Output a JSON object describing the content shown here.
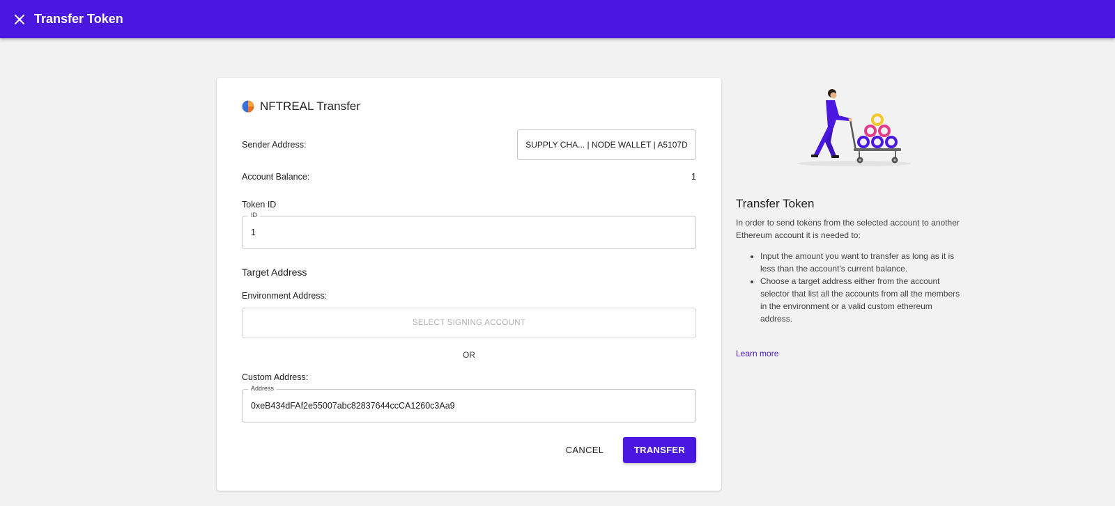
{
  "topbar": {
    "title": "Transfer Token",
    "close_icon": "close-icon",
    "background_color": "#4a17e0"
  },
  "form": {
    "title": "NFTREAL Transfer",
    "token_icon": "token-icon",
    "sender_label": "Sender Address:",
    "sender_value": "SUPPLY CHA... | NODE WALLET | A5107D",
    "balance_label": "Account Balance:",
    "balance_value": "1",
    "token_id_label": "Token ID",
    "token_id_legend": "ID",
    "token_id_value": "1",
    "target_section_title": "Target Address",
    "environment_label": "Environment Address:",
    "signing_account_button": "SELECT SIGNING ACCOUNT",
    "or_text": "OR",
    "custom_label": "Custom Address:",
    "custom_legend": "Address",
    "custom_value": "0xeB434dFAf2e55007abc82837644ccCA1260c3Aa9",
    "cancel_label": "CANCEL",
    "transfer_label": "TRANSFER"
  },
  "side": {
    "illustration": "person-pushing-cart-illustration",
    "title": "Transfer Token",
    "intro": "In order to send tokens from the selected account to another Ethereum account it is needed to:",
    "bullets": [
      "Input the amount you want to transfer as long as it is less than the account's current balance.",
      "Choose a target address either from the account selector that list all the accounts from all the members in the environment or a valid custom ethereum address."
    ],
    "learn_more": "Learn more",
    "accent_color": "#4a17e0"
  }
}
